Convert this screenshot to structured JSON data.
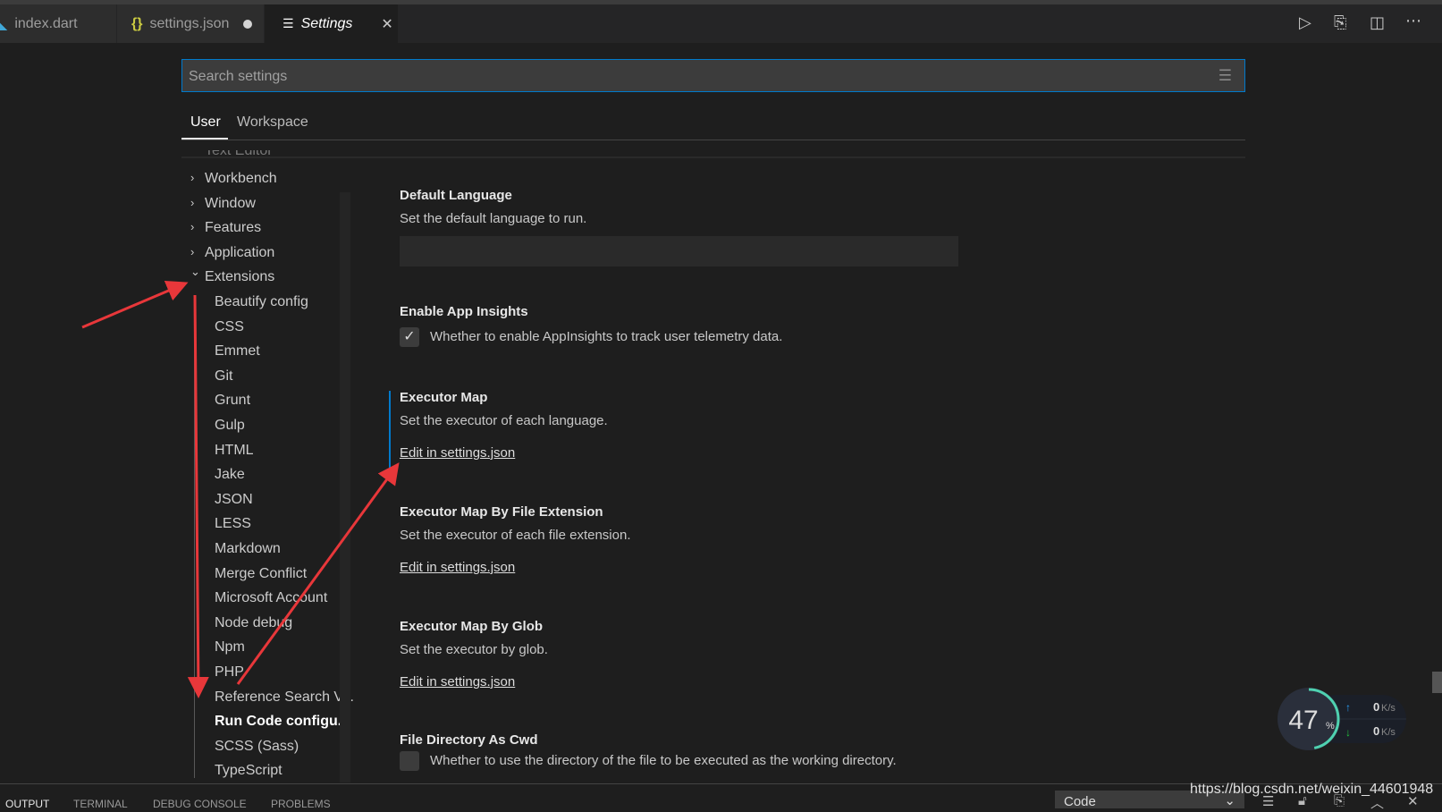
{
  "tabs": [
    {
      "label": "index.dart",
      "icon": "dart-icon"
    },
    {
      "label": "settings.json",
      "icon": "braces-icon",
      "modified": true
    },
    {
      "label": "Settings",
      "icon": "list-icon",
      "active": true
    }
  ],
  "toolbar": {
    "icons": [
      "run-icon",
      "open-settings-json-icon",
      "split-editor-icon",
      "more-icon"
    ]
  },
  "search": {
    "placeholder": "Search settings"
  },
  "scope_tabs": {
    "user": "User",
    "workspace": "Workspace"
  },
  "tree": {
    "partial": "Text Editor",
    "top": [
      "Workbench",
      "Window",
      "Features",
      "Application",
      "Extensions"
    ],
    "extensions": [
      "Beautify config",
      "CSS",
      "Emmet",
      "Git",
      "Grunt",
      "Gulp",
      "HTML",
      "Jake",
      "JSON",
      "LESS",
      "Markdown",
      "Merge Conflict",
      "Microsoft Account",
      "Node debug",
      "Npm",
      "PHP",
      "Reference Search V...",
      "Run Code configu...",
      "SCSS (Sass)",
      "TypeScript"
    ],
    "selected": "Run Code configu..."
  },
  "settings": {
    "default_language": {
      "title": "Default Language",
      "desc": "Set the default language to run.",
      "value": ""
    },
    "app_insights": {
      "title": "Enable App Insights",
      "desc": "Whether to enable AppInsights to track user telemetry data.",
      "checked": true
    },
    "executor_map": {
      "title": "Executor Map",
      "desc": "Set the executor of each language.",
      "link": "Edit in settings.json"
    },
    "executor_map_ext": {
      "title": "Executor Map By File Extension",
      "desc": "Set the executor of each file extension.",
      "link": "Edit in settings.json"
    },
    "executor_map_glob": {
      "title": "Executor Map By Glob",
      "desc": "Set the executor by glob.",
      "link": "Edit in settings.json"
    },
    "file_dir_cwd": {
      "title": "File Directory As Cwd",
      "desc": "Whether to use the directory of the file to be executed as the working directory.",
      "checked": false
    }
  },
  "panel": {
    "tabs": [
      "OUTPUT",
      "TERMINAL",
      "DEBUG CONSOLE",
      "PROBLEMS"
    ],
    "channel": "Code"
  },
  "widget": {
    "percent": "47",
    "percent_sign": "%",
    "up": "0",
    "down": "0",
    "unit": "K/s",
    "level_percent": 47
  },
  "watermark": "https://blog.csdn.net/weixin_44601948",
  "colors": {
    "accent": "#007acc",
    "annotation": "#e8373a"
  }
}
